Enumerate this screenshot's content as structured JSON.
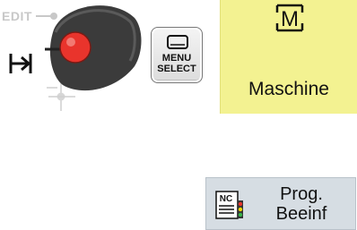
{
  "mode_selector": {
    "edit_label": "EDIT",
    "icons": [
      "edit-mode-icon",
      "jog-arrow-icon",
      "reference-point-icon",
      "mode-knob-icon"
    ],
    "indicator_color": "#e9342c"
  },
  "menu_select_key": {
    "line1": "MENU",
    "line2": "SELECT",
    "icon": "screen-icon"
  },
  "maschine_softkey": {
    "label": "Maschine",
    "icon_text": "M",
    "background": "#f3f291"
  },
  "prog_softkey": {
    "line1": "Prog.",
    "line2": "Beeinf",
    "icon_text": "NC",
    "background": "#d6dde3"
  }
}
